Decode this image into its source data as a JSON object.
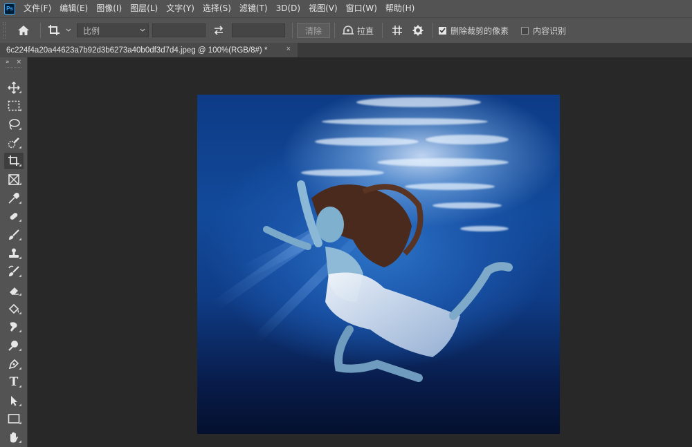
{
  "app": {
    "logo": "Ps"
  },
  "menu": [
    "文件(F)",
    "编辑(E)",
    "图像(I)",
    "图层(L)",
    "文字(Y)",
    "选择(S)",
    "滤镜(T)",
    "3D(D)",
    "视图(V)",
    "窗口(W)",
    "帮助(H)"
  ],
  "options": {
    "home_icon": "home-icon",
    "crop_icon": "crop-icon",
    "ratio_select": "比例",
    "width_value": "",
    "height_value": "",
    "swap_icon": "swap-arrows-icon",
    "clear_button": "清除",
    "straighten_label": "拉直",
    "grid_icon": "overlay-grid-icon",
    "settings_icon": "gear-icon",
    "delete_cropped_label": "删除裁剪的像素",
    "delete_cropped_checked": true,
    "content_aware_label": "内容识别",
    "content_aware_checked": false
  },
  "document": {
    "tab_title": "6c224f4a20a44623a7b92d3b6273a40b0df3d7d4.jpeg @ 100%(RGB/8#) *",
    "close_label": "×"
  },
  "toolbar": {
    "collapse": "»",
    "close": "×",
    "tools": [
      "move-tool",
      "marquee-tool",
      "lasso-tool",
      "quick-selection-tool",
      "crop-tool",
      "frame-tool",
      "eyedropper-tool",
      "healing-brush-tool",
      "brush-tool",
      "clone-stamp-tool",
      "history-brush-tool",
      "eraser-tool",
      "paint-bucket-tool",
      "smudge-tool",
      "dodge-tool",
      "pen-tool",
      "type-tool",
      "path-selection-tool",
      "rectangle-tool",
      "hand-tool"
    ],
    "active_tool": "crop-tool",
    "type_glyph": "T"
  },
  "colors": {
    "ui_dark": "#535353",
    "canvas_bg": "#282828",
    "accent": "#31a8ff"
  }
}
